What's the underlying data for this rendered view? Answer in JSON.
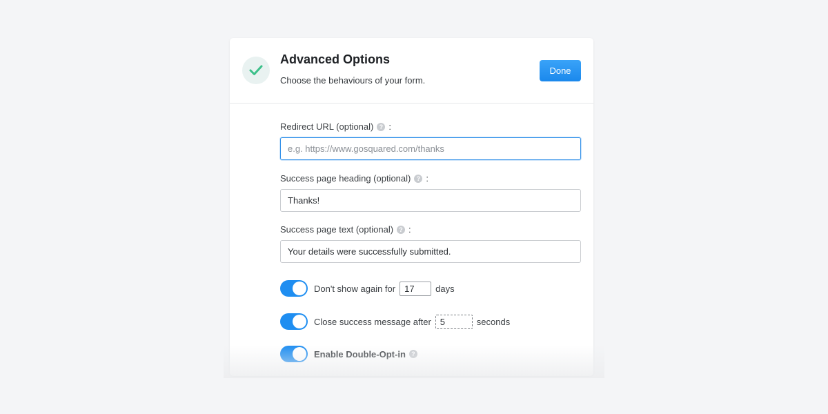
{
  "header": {
    "title": "Advanced Options",
    "subtitle": "Choose the behaviours of your form.",
    "done_label": "Done",
    "check_icon": "check-icon"
  },
  "fields": {
    "redirect_url": {
      "label": "Redirect URL (optional)",
      "suffix": ":",
      "placeholder": "e.g. https://www.gosquared.com/thanks",
      "value": ""
    },
    "success_heading": {
      "label": "Success page heading (optional)",
      "suffix": ":",
      "value": "Thanks!"
    },
    "success_text": {
      "label": "Success page text (optional)",
      "suffix": ":",
      "value": "Your details were successfully submitted."
    }
  },
  "toggles": {
    "dont_show": {
      "enabled": true,
      "prefix": "Don't show again for",
      "value": "17",
      "suffix": "days"
    },
    "close_message": {
      "enabled": true,
      "prefix": "Close success message after",
      "value": "5",
      "suffix": "seconds"
    },
    "double_opt_in": {
      "enabled": true,
      "label": "Enable Double-Opt-in"
    }
  },
  "help_glyph": "?",
  "colors": {
    "accent": "#1f8ef1",
    "check": "#3cc08a",
    "background": "#f4f5f7"
  }
}
